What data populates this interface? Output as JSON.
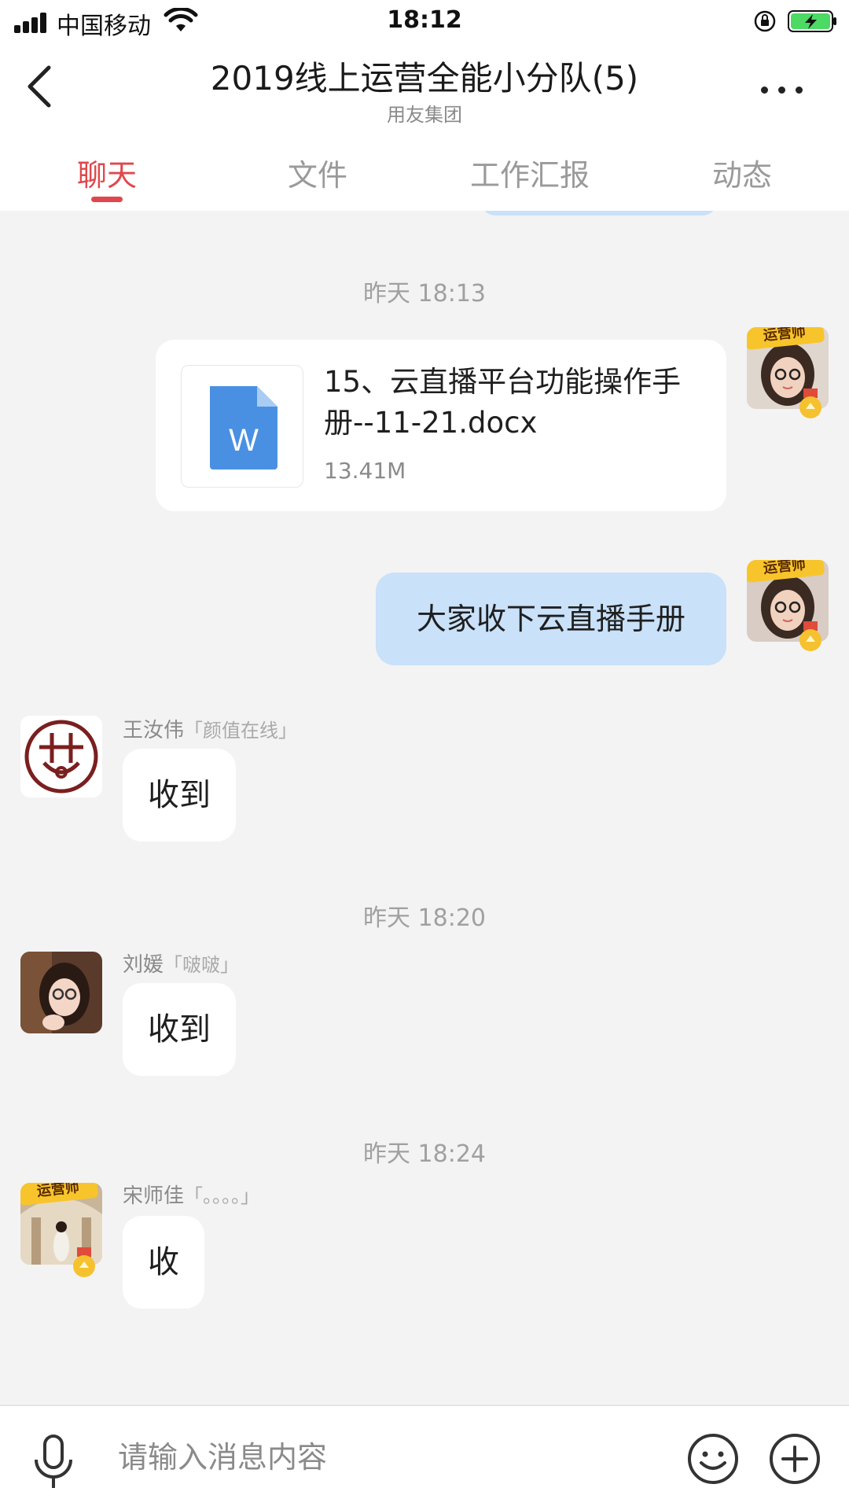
{
  "status_bar": {
    "carrier": "中国移动",
    "time": "18:12",
    "icons": [
      "signal-icon",
      "wifi-icon",
      "orientation-lock-icon",
      "battery-charging-icon"
    ]
  },
  "header": {
    "title": "2019线上运营全能小分队(5)",
    "subtitle": "用友集团"
  },
  "tabs": [
    {
      "label": "聊天",
      "active": true
    },
    {
      "label": "文件",
      "active": false
    },
    {
      "label": "工作汇报",
      "active": false
    },
    {
      "label": "动态",
      "active": false
    }
  ],
  "colors": {
    "accent": "#e0474c",
    "outgoing_bubble": "#c9e1f9",
    "background": "#f3f3f4"
  },
  "messages": {
    "time_1": "昨天 18:13",
    "file": {
      "name": "15、云直播平台功能操作手册--11-21.docx",
      "size": "13.41M",
      "icon_letter": "W",
      "icon": "word-doc-icon"
    },
    "self_text": "大家收下云直播手册",
    "self_badge": "运营师",
    "msg_wang": {
      "name": "王汝伟",
      "nick": "「颜值在线」",
      "text": "收到"
    },
    "time_2": "昨天 18:20",
    "msg_liu": {
      "name": "刘媛",
      "nick": "「啵啵」",
      "text": "收到"
    },
    "time_3": "昨天 18:24",
    "msg_song": {
      "name": "宋师佳",
      "nick": "「。。。。」",
      "text": "收",
      "badge": "运营师"
    }
  },
  "input_bar": {
    "placeholder": "请输入消息内容",
    "icons": [
      "microphone-icon",
      "emoji-icon",
      "plus-icon"
    ]
  }
}
